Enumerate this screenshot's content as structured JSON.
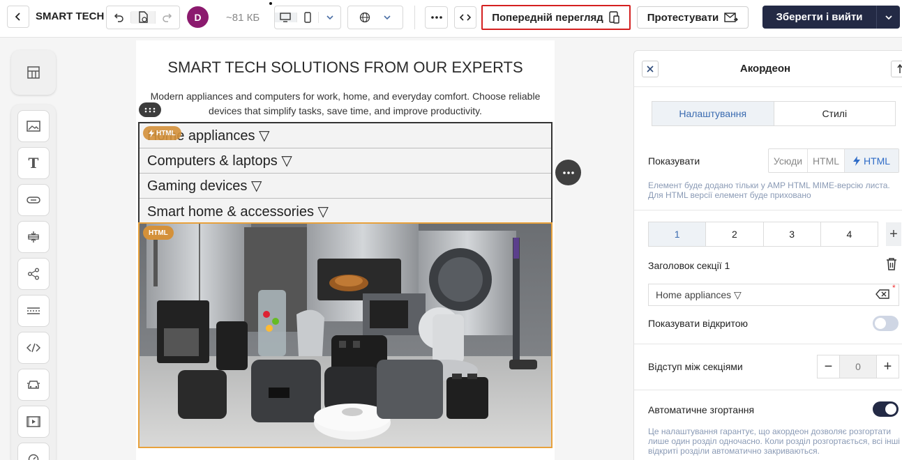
{
  "topbar": {
    "brand": "SMART TECH",
    "avatar_initial": "D",
    "email_size": "~81 КБ",
    "preview_label": "Попередній перегляд",
    "test_label": "Протестувати",
    "save_label": "Зберегти і вийти"
  },
  "canvas": {
    "headline": "SMART TECH SOLUTIONS FROM OUR EXPERTS",
    "subtext": "Modern appliances and computers for work, home, and everyday comfort. Choose reliable devices that simplify tasks, save time, and improve productivity.",
    "accordion_items": [
      "Home appliances ▽",
      "Computers & laptops ▽",
      "Gaming devices ▽",
      "Smart home & accessories ▽"
    ],
    "badge_html": "HTML"
  },
  "panel": {
    "title": "Акордеон",
    "tab_settings": "Налаштування",
    "tab_styles": "Стилі",
    "show_label": "Показувати",
    "show_options": [
      "Усюди",
      "HTML",
      "HTML"
    ],
    "show_hint": "Елемент буде додано тільки у AMP HTML MIME-версію листа. Для HTML версії елемент буде приховано",
    "sections": [
      "1",
      "2",
      "3",
      "4"
    ],
    "section_title_label": "Заголовок секції 1",
    "section_title_value": "Home appliances ▽",
    "show_open_label": "Показувати відкритою",
    "spacing_label": "Відступ між секціями",
    "spacing_value": "0",
    "autocollapse_label": "Автоматичне згортання",
    "autocollapse_hint": "Це налаштування гарантує, що акордеон дозволяє розгортати лише один розділ одночасно. Коли розділ розгортається, всі інші відкриті розділи автоматично закриваються."
  },
  "colors": {
    "accent_dark": "#232a45",
    "preview_highlight": "#d42020",
    "html_badge": "#d4913a",
    "avatar": "#8b1a6e"
  }
}
